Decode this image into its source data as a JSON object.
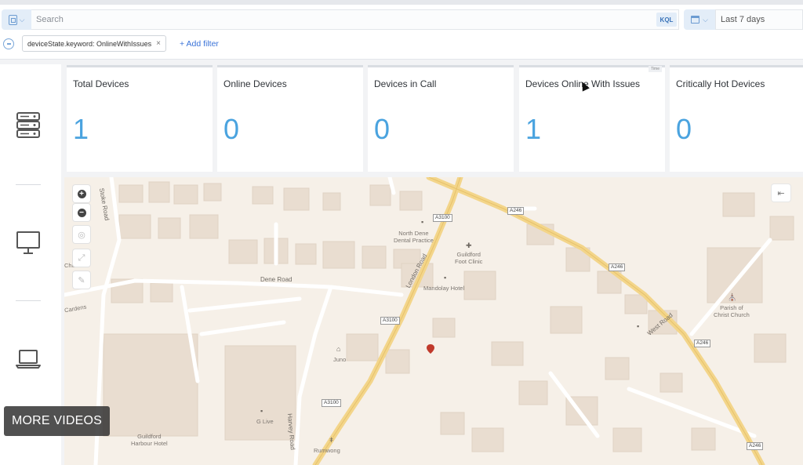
{
  "query_bar": {
    "search_placeholder": "Search",
    "language_label": "KQL",
    "date_range": "Last 7 days"
  },
  "filters": {
    "active": [
      "deviceState.keyword: OnlineWithIssues"
    ],
    "add_filter_label": "+ Add filter"
  },
  "sidebar": {
    "items": [
      {
        "icon": "server-rack-icon"
      },
      {
        "icon": "monitor-icon"
      },
      {
        "icon": "laptop-icon"
      }
    ]
  },
  "metrics": [
    {
      "title": "Total Devices",
      "value": "1"
    },
    {
      "title": "Online Devices",
      "value": "0"
    },
    {
      "title": "Devices in Call",
      "value": "0"
    },
    {
      "title": "Devices Online With Issues",
      "value": "1"
    },
    {
      "title": "Critically Hot Devices",
      "value": "0"
    }
  ],
  "metric_card_tag": "Time",
  "map": {
    "road_labels": [
      "Dene Road",
      "London Road",
      "West Road",
      "Stoke Road",
      "Harvey Road"
    ],
    "shields": [
      "A3100",
      "A246",
      "A246",
      "A3100",
      "A3100",
      "A246",
      "A246"
    ],
    "pois": [
      {
        "name": "North Dene\nDental Practice"
      },
      {
        "name": "Guildford\nFoot Clinic"
      },
      {
        "name": "Mandolay Hotel"
      },
      {
        "name": "Parish of\nChrist Church"
      },
      {
        "name": "Juno"
      },
      {
        "name": "G Live"
      },
      {
        "name": "Guildford\nHarbour Hotel"
      },
      {
        "name": "Rumwong"
      },
      {
        "name": "Cardens"
      },
      {
        "name": "Church"
      }
    ],
    "marker_color": "#c0392b"
  },
  "overlay": {
    "more_videos": "MORE VIDEOS"
  }
}
